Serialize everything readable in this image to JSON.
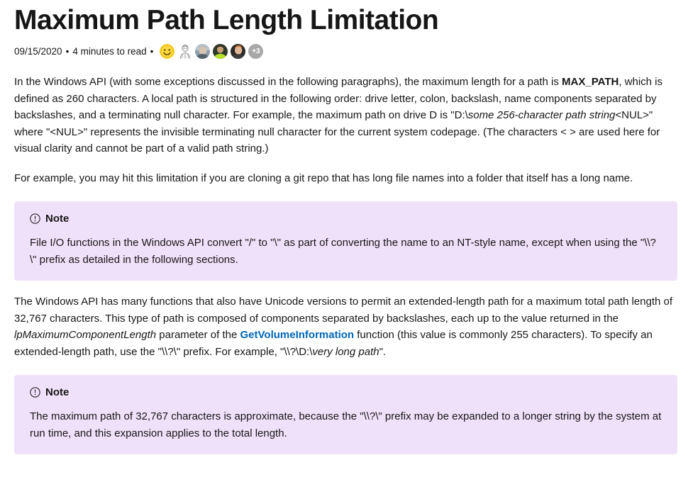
{
  "article": {
    "title": "Maximum Path Length Limitation",
    "meta": {
      "date": "09/15/2020",
      "separator": "•",
      "read_time": "4 minutes to read",
      "contributors": [
        {
          "name": "smiley-emoji-avatar",
          "type": "emoji",
          "color": "#ffd83d"
        },
        {
          "name": "sketch-avatar",
          "type": "sketch",
          "color": "#9a9a9a"
        },
        {
          "name": "photo-avatar-1",
          "type": "photo",
          "color": "#8d9aa6"
        },
        {
          "name": "photo-avatar-2",
          "type": "photo",
          "color": "#b6e02a"
        },
        {
          "name": "photo-avatar-3",
          "type": "photo",
          "color": "#c2642a"
        }
      ],
      "overflow_count": "+3",
      "overflow_color": "#a8a8a8"
    },
    "paragraphs": [
      {
        "id": "p1",
        "segments": [
          {
            "text": "In the Windows API (with some exceptions discussed in the following paragraphs), the maximum length for a path is ",
            "style": "normal"
          },
          {
            "text": "MAX_PATH",
            "style": "bold"
          },
          {
            "text": ", which is defined as 260 characters. A local path is structured in the following order: drive letter, colon, backslash, name components separated by backslashes, and a terminating null character. For example, the maximum path on drive D is \"D:\\",
            "style": "normal"
          },
          {
            "text": "some 256-character path string",
            "style": "italic"
          },
          {
            "text": "<NUL>\" where \"<NUL>\" represents the invisible terminating null character for the current system codepage. (The characters < > are used here for visual clarity and cannot be part of a valid path string.)",
            "style": "normal"
          }
        ]
      },
      {
        "id": "p2",
        "segments": [
          {
            "text": "For example, you may hit this limitation if you are cloning a git repo that has long file names into a folder that itself has a long name.",
            "style": "normal"
          }
        ]
      },
      {
        "id": "p3",
        "segments": [
          {
            "text": "The Windows API has many functions that also have Unicode versions to permit an extended-length path for a maximum total path length of 32,767 characters. This type of path is composed of components separated by backslashes, each up to the value returned in the ",
            "style": "normal"
          },
          {
            "text": "lpMaximumComponentLength",
            "style": "italic"
          },
          {
            "text": " parameter of the ",
            "style": "normal"
          },
          {
            "text": "GetVolumeInformation",
            "style": "link"
          },
          {
            "text": " function (this value is commonly 255 characters). To specify an extended-length path, use the \"\\\\?\\\" prefix. For example, \"\\\\?\\D:\\",
            "style": "normal"
          },
          {
            "text": "very long path",
            "style": "italic"
          },
          {
            "text": "\".",
            "style": "normal"
          }
        ]
      }
    ],
    "notes": [
      {
        "id": "note1",
        "icon": "info-circle-icon",
        "label": "Note",
        "text": "File I/O functions in the Windows API convert \"/\" to \"\\\" as part of converting the name to an NT-style name, except when using the \"\\\\?\\\" prefix as detailed in the following sections."
      },
      {
        "id": "note2",
        "icon": "info-circle-icon",
        "label": "Note",
        "text": "The maximum path of 32,767 characters is approximate, because the \"\\\\?\\\" prefix may be expanded to a longer string by the system at run time, and this expansion applies to the total length."
      }
    ],
    "colors": {
      "note_background": "#f0e1fa",
      "link": "#0067b8",
      "text": "#171717",
      "title": "#161616",
      "page_background": "#ffffff"
    }
  }
}
